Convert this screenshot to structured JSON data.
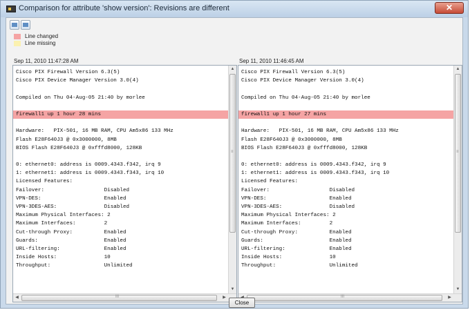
{
  "window": {
    "title": "Comparison for attribute 'show version': Revisions are different",
    "close_glyph": "✕"
  },
  "toolbar": {
    "buttons": [
      {
        "icon": "previous-diff-icon"
      },
      {
        "icon": "next-diff-icon"
      }
    ]
  },
  "legend": {
    "changed": {
      "label": "Line changed",
      "color": "#f5a4a4"
    },
    "missing": {
      "label": "Line missing",
      "color": "#fbf1b0"
    }
  },
  "left": {
    "timestamp": "Sep 11, 2010 11:47:28 AM",
    "lines": [
      {
        "text": "Cisco PIX Firewall Version 6.3(5)",
        "state": ""
      },
      {
        "text": "Cisco PIX Device Manager Version 3.0(4)",
        "state": ""
      },
      {
        "text": "",
        "state": ""
      },
      {
        "text": "Compiled on Thu 04-Aug-05 21:40 by morlee",
        "state": ""
      },
      {
        "text": "",
        "state": ""
      },
      {
        "text": "firewall1 up 1 hour 28 mins",
        "state": "changed"
      },
      {
        "text": "",
        "state": ""
      },
      {
        "text": "Hardware:   PIX-501, 16 MB RAM, CPU Am5x86 133 MHz",
        "state": ""
      },
      {
        "text": "Flash E28F640J3 @ 0x3000000, 8MB",
        "state": ""
      },
      {
        "text": "BIOS Flash E28F640J3 @ 0xfffd8000, 128KB",
        "state": ""
      },
      {
        "text": "",
        "state": ""
      },
      {
        "text": "0: ethernet0: address is 0009.4343.f342, irq 9",
        "state": ""
      },
      {
        "text": "1: ethernet1: address is 0009.4343.f343, irq 10",
        "state": ""
      },
      {
        "text": "Licensed Features:",
        "state": ""
      },
      {
        "text": "Failover:                   Disabled",
        "state": ""
      },
      {
        "text": "VPN-DES:                    Enabled",
        "state": ""
      },
      {
        "text": "VPN-3DES-AES:               Disabled",
        "state": ""
      },
      {
        "text": "Maximum Physical Interfaces: 2",
        "state": ""
      },
      {
        "text": "Maximum Interfaces:         2",
        "state": ""
      },
      {
        "text": "Cut-through Proxy:          Enabled",
        "state": ""
      },
      {
        "text": "Guards:                     Enabled",
        "state": ""
      },
      {
        "text": "URL-filtering:              Enabled",
        "state": ""
      },
      {
        "text": "Inside Hosts:               10",
        "state": ""
      },
      {
        "text": "Throughput:                 Unlimited",
        "state": ""
      }
    ]
  },
  "right": {
    "timestamp": "Sep 11, 2010 11:46:45 AM",
    "lines": [
      {
        "text": "Cisco PIX Firewall Version 6.3(5)",
        "state": ""
      },
      {
        "text": "Cisco PIX Device Manager Version 3.0(4)",
        "state": ""
      },
      {
        "text": "",
        "state": ""
      },
      {
        "text": "Compiled on Thu 04-Aug-05 21:40 by morlee",
        "state": ""
      },
      {
        "text": "",
        "state": ""
      },
      {
        "text": "firewall1 up 1 hour 27 mins",
        "state": "changed"
      },
      {
        "text": "",
        "state": ""
      },
      {
        "text": "Hardware:   PIX-501, 16 MB RAM, CPU Am5x86 133 MHz",
        "state": ""
      },
      {
        "text": "Flash E28F640J3 @ 0x3000000, 8MB",
        "state": ""
      },
      {
        "text": "BIOS Flash E28F640J3 @ 0xfffd8000, 128KB",
        "state": ""
      },
      {
        "text": "",
        "state": ""
      },
      {
        "text": "0: ethernet0: address is 0009.4343.f342, irq 9",
        "state": ""
      },
      {
        "text": "1: ethernet1: address is 0009.4343.f343, irq 10",
        "state": ""
      },
      {
        "text": "Licensed Features:",
        "state": ""
      },
      {
        "text": "Failover:                   Disabled",
        "state": ""
      },
      {
        "text": "VPN-DES:                    Enabled",
        "state": ""
      },
      {
        "text": "VPN-3DES-AES:               Disabled",
        "state": ""
      },
      {
        "text": "Maximum Physical Interfaces: 2",
        "state": ""
      },
      {
        "text": "Maximum Interfaces:         2",
        "state": ""
      },
      {
        "text": "Cut-through Proxy:          Enabled",
        "state": ""
      },
      {
        "text": "Guards:                     Enabled",
        "state": ""
      },
      {
        "text": "URL-filtering:              Enabled",
        "state": ""
      },
      {
        "text": "Inside Hosts:               10",
        "state": ""
      },
      {
        "text": "Throughput:                 Unlimited",
        "state": ""
      }
    ]
  },
  "scroll_glyphs": {
    "up": "▲",
    "down": "▼",
    "left": "◀",
    "right": "▶",
    "grip_v": "≡",
    "grip_h": "III"
  },
  "footer": {
    "close_label": "Close"
  }
}
